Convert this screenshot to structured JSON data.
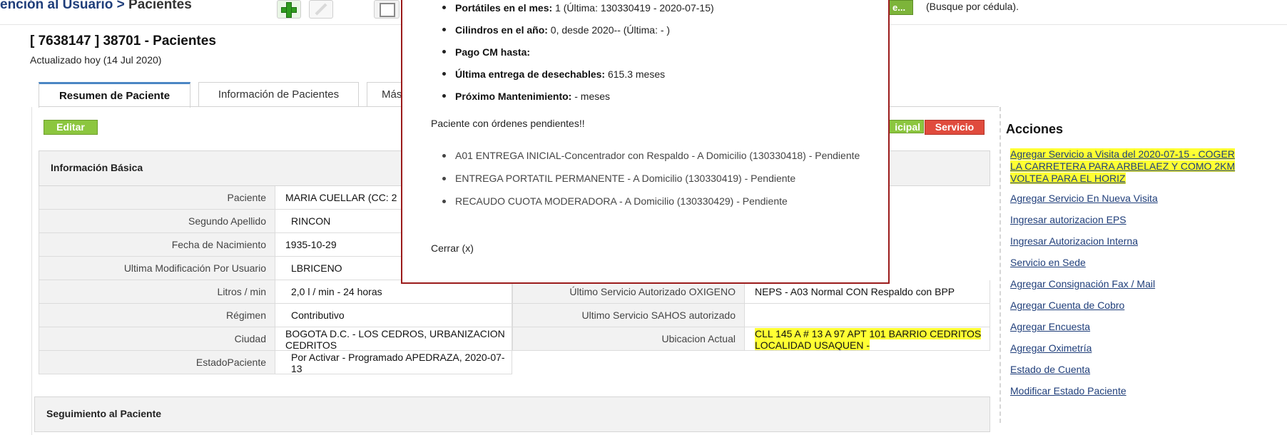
{
  "header": {
    "breadcrumb_parent": "ención al Usuario",
    "breadcrumb_separator": ">",
    "breadcrumb_current": "Pacientes",
    "search_button_label": "e...",
    "search_hint": "(Busque por cédula)."
  },
  "patient": {
    "heading": "[ 7638147 ] 38701 - Pacientes",
    "updated": "Actualizado hoy (14 Jul 2020)"
  },
  "tabs": [
    {
      "label": "Resumen de Paciente",
      "active": true
    },
    {
      "label": "Información de Pacientes",
      "active": false
    },
    {
      "label": "Más",
      "active": false
    }
  ],
  "buttons": {
    "editar": "Editar",
    "principal": "icipal",
    "servicio": "Servicio"
  },
  "basic_info": {
    "title": "Información Básica",
    "rows": [
      {
        "label": "Paciente",
        "value": "MARIA CUELLAR (CC: 2"
      },
      {
        "label": "Segundo Apellido",
        "value": "RINCON"
      },
      {
        "label": "Fecha de Nacimiento",
        "value": "1935-10-29"
      },
      {
        "label": "Ultima Modificación Por Usuario",
        "value": "LBRICENO"
      },
      {
        "label": "Litros / min",
        "value": "2,0 l / min - 24 horas"
      },
      {
        "label": "Régimen",
        "value": "Contributivo"
      },
      {
        "label": "Ciudad",
        "value": "BOGOTA D.C. - LOS CEDROS, URBANIZACION CEDRITOS"
      },
      {
        "label": "EstadoPaciente",
        "value": "Por Activar - Programado APEDRAZA, 2020-07-13"
      }
    ],
    "right_rows": [
      {
        "label": "Último Servicio Autorizado OXIGENO",
        "value": "NEPS - A03 Normal CON Respaldo con BPP"
      },
      {
        "label": "Ultimo Servicio SAHOS autorizado",
        "value": ""
      },
      {
        "label": "Ubicacion Actual",
        "value": "CLL 145 A # 13 A 97 APT 101 BARRIO CEDRITOS LOCALIDAD USAQUEN -"
      }
    ]
  },
  "seguimiento": {
    "title": "Seguimiento al Paciente"
  },
  "acciones": {
    "title": "Acciones",
    "first_link": "Agregar Servicio a Visita del 2020-07-15 - COGER LA CARRETERA PARA ARBELAEZ Y COMO 2KM VOLTEA PARA EL HORIZ",
    "links": [
      "Agregar Servicio En Nueva Visita",
      "Ingresar autorizacion EPS",
      "Ingresar Autorizacion Interna",
      "Servicio en Sede",
      "Agregar Consignación Fax / Mail",
      "Agregar Cuenta de Cobro",
      "Agregar Encuesta",
      "Agregar Oximetría",
      "Estado de Cuenta",
      "Modificar Estado Paciente"
    ]
  },
  "popup": {
    "items": [
      {
        "label": "Portátiles en el mes:",
        "value": "1 (Última: 130330419 - 2020-07-15)"
      },
      {
        "label": "Cilindros en el año:",
        "value": "0, desde 2020-- (Última: - )"
      },
      {
        "label": "Pago CM hasta:",
        "value": ""
      },
      {
        "label": "Última entrega de desechables:",
        "value": "615.3 meses"
      },
      {
        "label": "Próximo Mantenimiento:",
        "value": "- meses"
      }
    ],
    "note": "Paciente con órdenes pendientes!!",
    "orders": [
      "A01 ENTREGA INICIAL-Concentrador con Respaldo - A Domicilio (130330418) - Pendiente",
      "ENTREGA PORTATIL PERMANENTE - A Domicilio (130330419) - Pendiente",
      "RECAUDO CUOTA MODERADORA - A Domicilio (130330429) - Pendiente"
    ],
    "close": "Cerrar (x)"
  },
  "colors": {
    "highlight": "#ffff33",
    "popup_border": "#9b1b1b",
    "green_button": "#8cc63f",
    "red_button": "#e04b3d",
    "link": "#1f3e7a"
  }
}
